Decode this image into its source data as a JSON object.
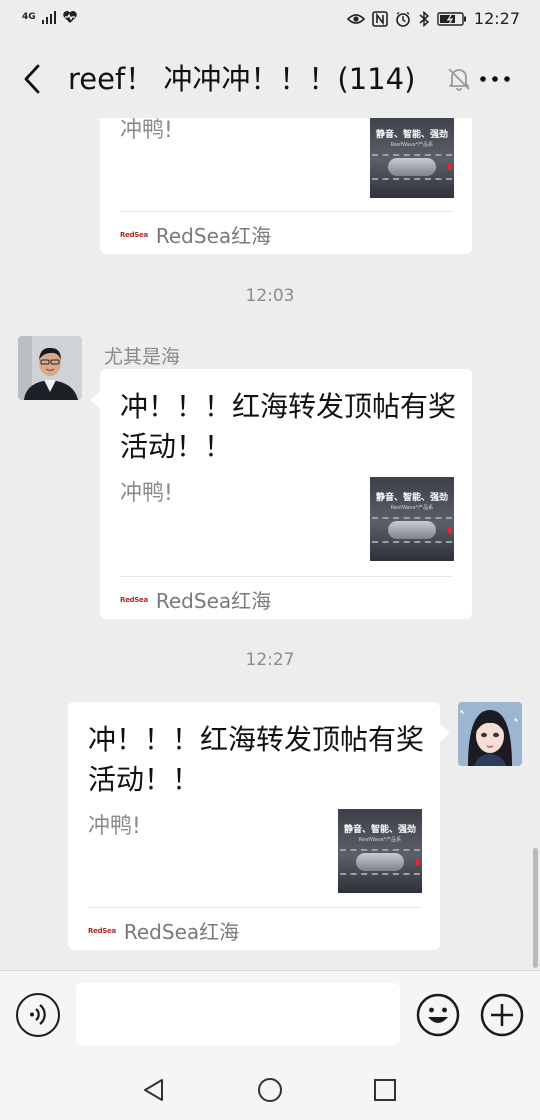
{
  "status": {
    "network": "4G",
    "time": "12:27"
  },
  "header": {
    "title": "reef！ 冲冲冲！！！(114)"
  },
  "colors": {
    "background": "#ededed",
    "card": "#ffffff",
    "muted_text": "#8a8a8a",
    "brand_red": "#b02a2a"
  },
  "messages": [
    {
      "type": "link-card",
      "side": "left",
      "desc": "冲鸭!",
      "thumb_text": "静音、智能、强劲",
      "thumb_sub": "ReefWave*产品系",
      "source_logo": "RedSea",
      "source": "RedSea红海"
    },
    {
      "type": "time",
      "text": "12:03"
    },
    {
      "type": "link-card",
      "side": "left",
      "sender": "尤其是海",
      "title": "冲！！！红海转发顶帖有奖活动！！",
      "desc": "冲鸭!",
      "thumb_text": "静音、智能、强劲",
      "thumb_sub": "ReefWave*产品系",
      "source_logo": "RedSea",
      "source": "RedSea红海"
    },
    {
      "type": "time",
      "text": "12:27"
    },
    {
      "type": "link-card",
      "side": "right",
      "title": "冲！！！红海转发顶帖有奖活动！！",
      "desc": "冲鸭!",
      "thumb_text": "静音、智能、强劲",
      "thumb_sub": "ReefWave*产品系",
      "source_logo": "RedSea",
      "source": "RedSea红海"
    }
  ],
  "icons": {
    "back": "chevron-left-icon",
    "mute": "bell-off-icon",
    "more": "more-horizontal-icon",
    "voice": "voice-icon",
    "emoji": "emoji-icon",
    "plus": "plus-circle-icon",
    "nav_back": "triangle-back-icon",
    "nav_home": "circle-home-icon",
    "nav_recent": "square-recent-icon"
  }
}
